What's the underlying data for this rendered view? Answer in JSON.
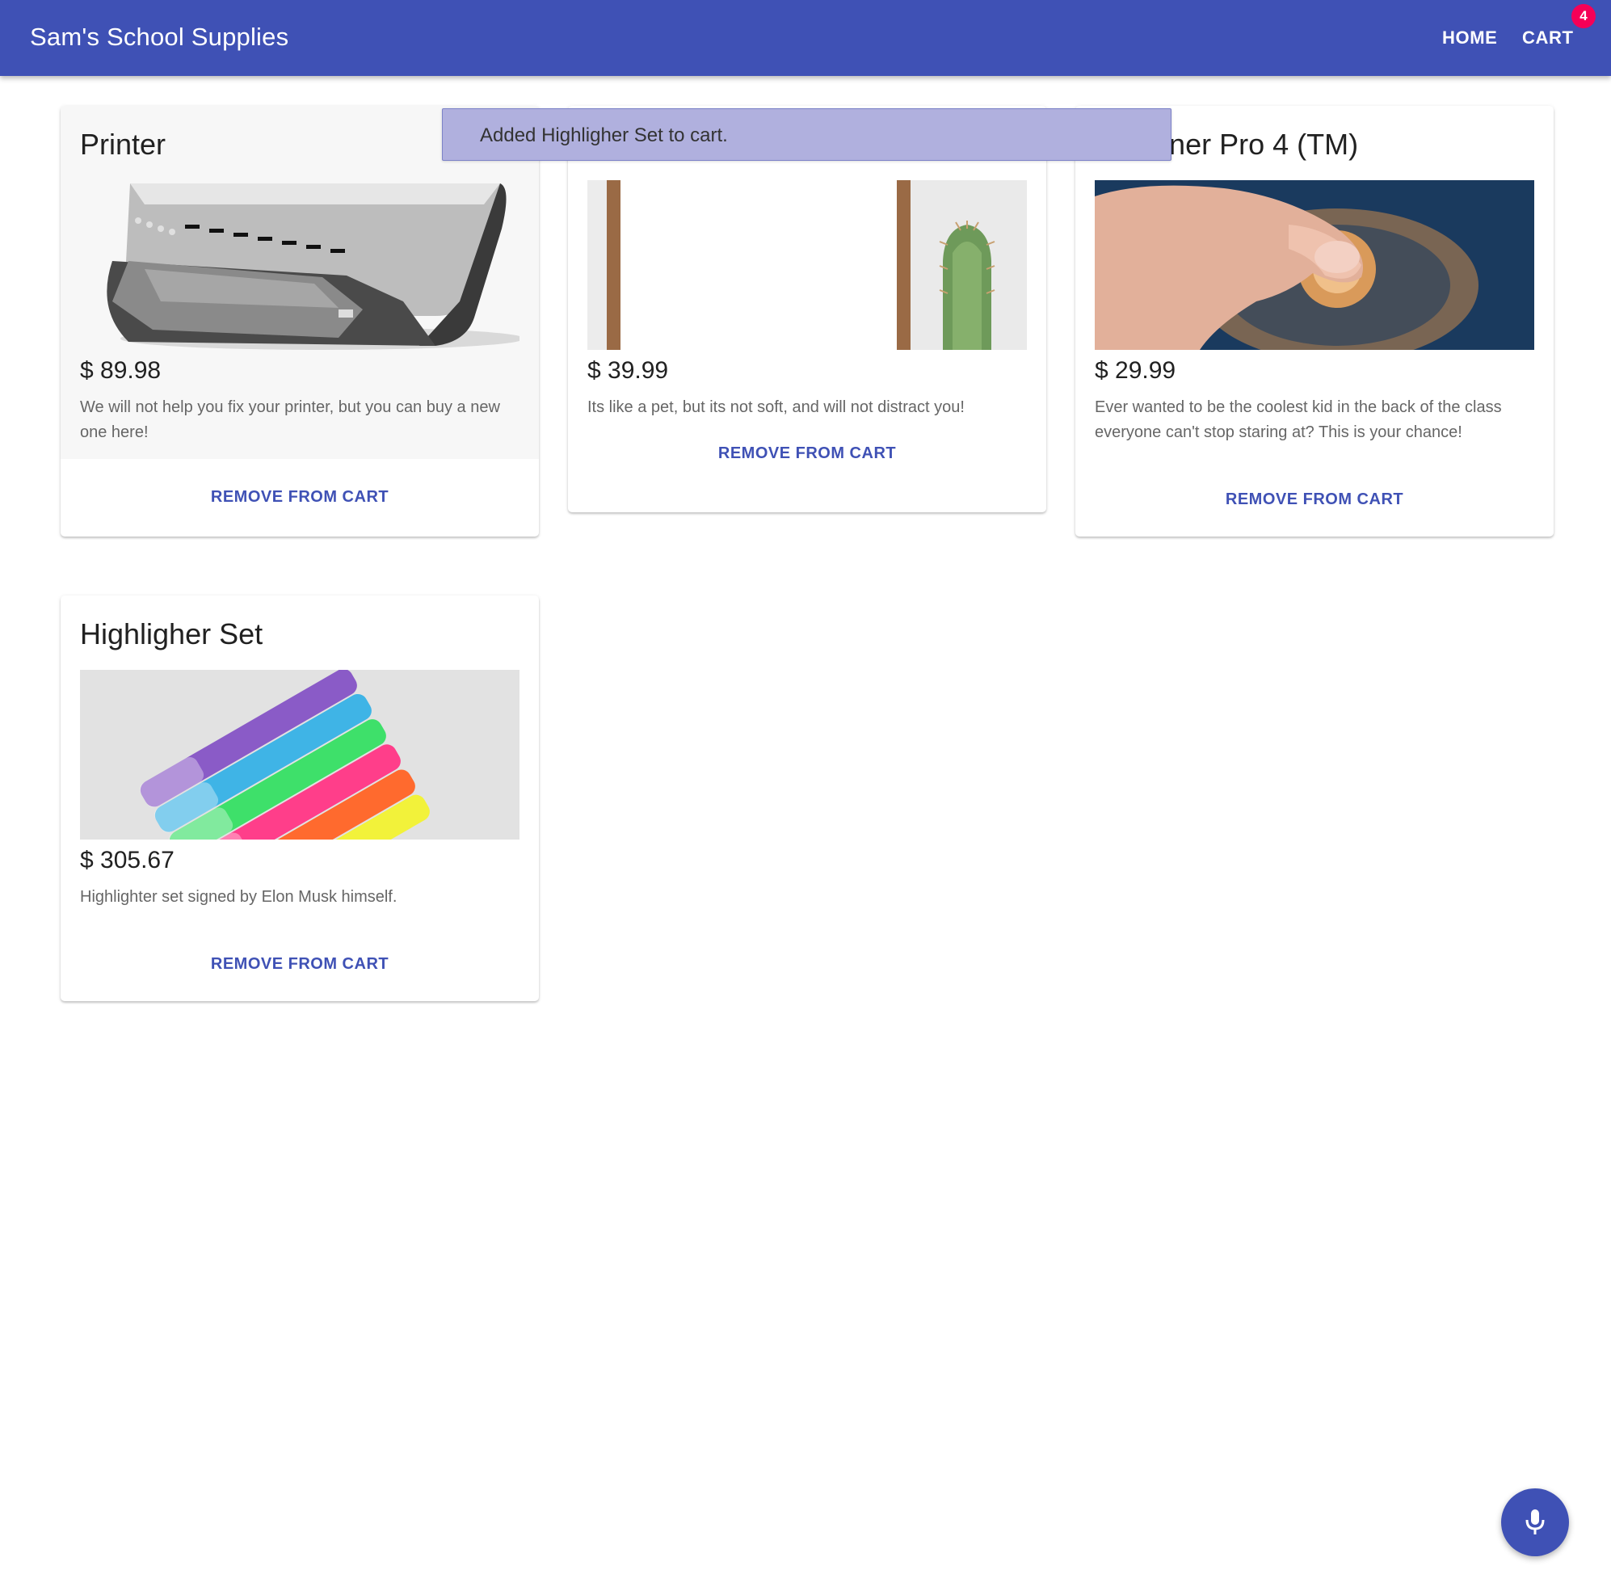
{
  "appbar": {
    "title": "Sam's School Supplies",
    "home_label": "HOME",
    "cart_label": "CART",
    "cart_count": "4",
    "bg_color": "#3f51b5",
    "badge_color": "#f50057"
  },
  "snackbar": {
    "message": "Added Highligher Set to cart."
  },
  "cards": [
    {
      "title": "Printer",
      "price": "$ 89.98",
      "description": "We will not help you fix your printer, but you can buy a new one here!",
      "action": "REMOVE FROM CART",
      "image": "printer-image"
    },
    {
      "title": "",
      "price": "$ 39.99",
      "description": "Its like a pet, but its not soft, and will not distract you!",
      "action": "REMOVE FROM CART",
      "image": "cactus-image"
    },
    {
      "title": "t Spinner Pro 4 (TM)",
      "price": "$ 29.99",
      "description": "Ever wanted to be the coolest kid in the back of the class everyone can't stop staring at? This is your chance!",
      "action": "REMOVE FROM CART",
      "image": "fidget-spinner-image"
    },
    {
      "title": "Highligher Set",
      "price": "$ 305.67",
      "description": "Highlighter set signed by Elon Musk himself.",
      "action": "REMOVE FROM CART",
      "image": "highlighter-set-image"
    }
  ],
  "fab": {
    "icon": "microphone-icon"
  }
}
